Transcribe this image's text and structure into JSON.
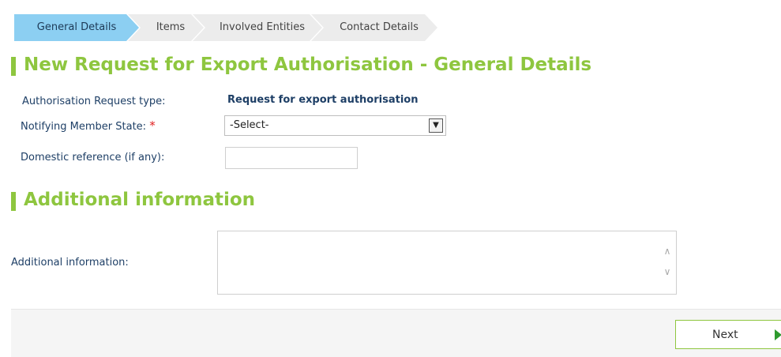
{
  "wizard": {
    "steps": [
      {
        "label": "General Details",
        "active": true
      },
      {
        "label": "Items",
        "active": false
      },
      {
        "label": "Involved Entities",
        "active": false
      },
      {
        "label": "Contact Details",
        "active": false
      }
    ]
  },
  "page_title": "New Request for Export Authorisation - General Details",
  "form": {
    "request_type_label": "Authorisation Request type:",
    "request_type_value": "Request for export authorisation",
    "member_state_label": "Notifying Member State:",
    "required_marker": "*",
    "member_state_value": "-Select-",
    "domestic_ref_label": "Domestic reference (if any):",
    "domestic_ref_value": ""
  },
  "additional": {
    "section_title": "Additional information",
    "field_label": "Additional information:",
    "field_value": ""
  },
  "footer": {
    "next_label": "Next"
  },
  "colors": {
    "accent_green": "#8ec63f",
    "active_step": "#8ccff2",
    "label_text": "#1e3f66"
  }
}
